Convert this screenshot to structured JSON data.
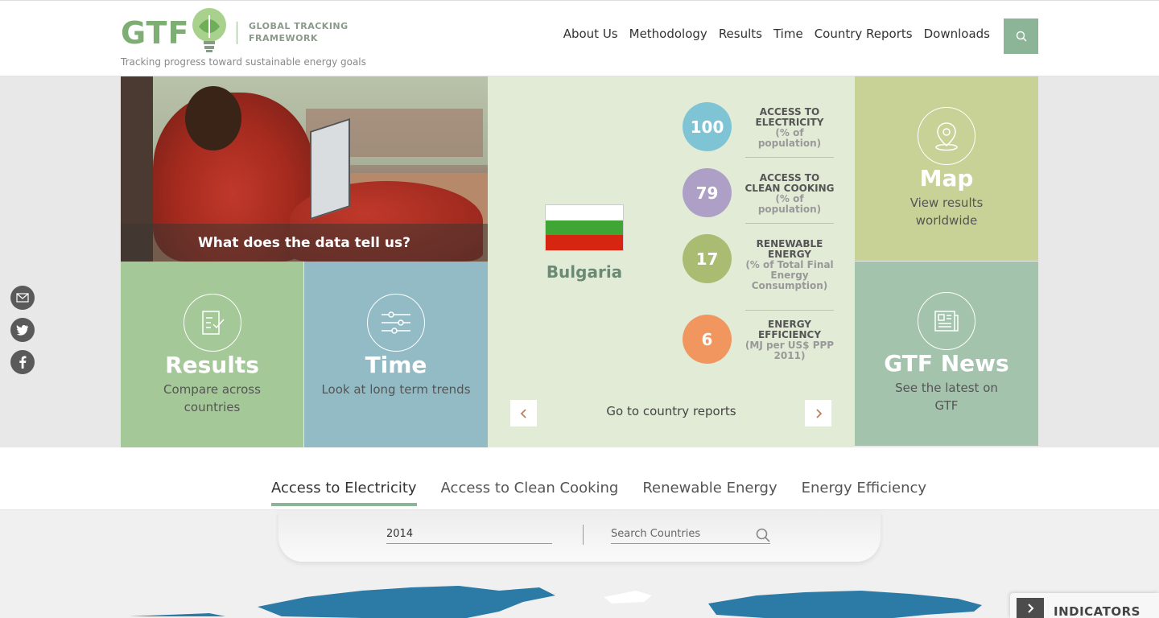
{
  "header": {
    "logo_text": "GTF",
    "logo_subtitle_line1": "GLOBAL TRACKING",
    "logo_subtitle_line2": "FRAMEWORK",
    "tagline": "Tracking progress toward sustainable energy goals",
    "nav": [
      "About Us",
      "Methodology",
      "Results",
      "Time",
      "Country Reports",
      "Downloads"
    ],
    "search_icon": "search-icon"
  },
  "hero": {
    "caption": "What does the data tell us?"
  },
  "tiles": {
    "results": {
      "title": "Results",
      "subtitle": "Compare across countries",
      "icon": "checklist-icon"
    },
    "time": {
      "title": "Time",
      "subtitle": "Look at long term trends",
      "icon": "sliders-icon"
    },
    "map": {
      "title": "Map",
      "subtitle": "View results worldwide",
      "icon": "map-pin-icon"
    },
    "news": {
      "title": "GTF News",
      "subtitle": "See the latest on GTF",
      "icon": "newspaper-icon"
    }
  },
  "country": {
    "name": "Bulgaria",
    "flag_colors": [
      "#ffffff",
      "#3fa535",
      "#d62612"
    ],
    "stats": [
      {
        "value": "100",
        "label": "ACCESS TO ELECTRICITY",
        "unit": "(% of population)",
        "color": "#7fc4d4"
      },
      {
        "value": "79",
        "label": "ACCESS TO CLEAN COOKING",
        "unit": "(% of population)",
        "color": "#ad9fc6"
      },
      {
        "value": "17",
        "label": "RENEWABLE ENERGY",
        "unit": "(% of Total Final Energy Consumption)",
        "color": "#aabb72"
      },
      {
        "value": "6",
        "label": "ENERGY EFFICIENCY",
        "unit": "(MJ per US$ PPP 2011)",
        "color": "#f0965e"
      }
    ],
    "go_reports": "Go to country reports",
    "prev_icon": "chevron-left-icon",
    "next_icon": "chevron-right-icon"
  },
  "social": [
    {
      "icon": "email-icon"
    },
    {
      "icon": "twitter-icon"
    },
    {
      "icon": "facebook-icon"
    }
  ],
  "tabs": [
    "Access to Electricity",
    "Access to Clean Cooking",
    "Renewable Energy",
    "Energy Efficiency"
  ],
  "active_tab": "Access to Electricity",
  "filters": {
    "year": "2014",
    "search_placeholder": "Search Countries"
  },
  "indicators": {
    "label": "INDICATORS"
  },
  "colors": {
    "brand_green": "#7fae75",
    "map_blue": "#2c7aa6"
  }
}
